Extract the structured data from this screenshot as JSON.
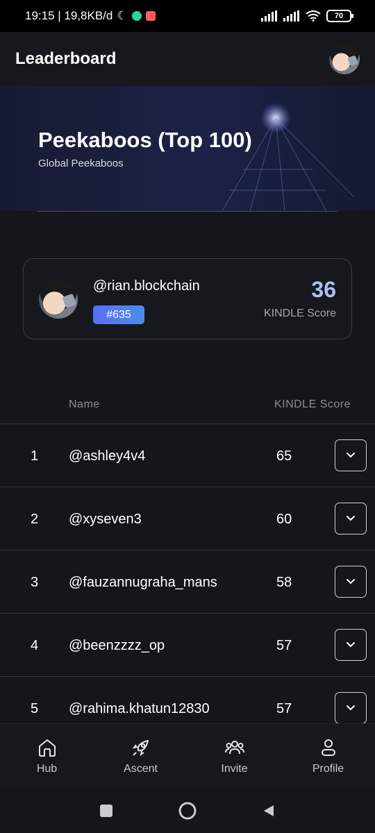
{
  "status_bar": {
    "time_info": "19:15 | 19,8KB/d",
    "battery": "70"
  },
  "header": {
    "title": "Leaderboard"
  },
  "banner": {
    "title": "Peekaboos  (Top 100)",
    "subtitle": "Global Peekaboos"
  },
  "my_rank": {
    "handle": "@rian.blockchain",
    "rank": "#635",
    "score": "36",
    "score_label": "KINDLE Score"
  },
  "table": {
    "col_name": "Name",
    "col_score": "KINDLE Score",
    "rows": [
      {
        "rank": "1",
        "name": "@ashley4v4",
        "score": "65"
      },
      {
        "rank": "2",
        "name": "@xyseven3",
        "score": "60"
      },
      {
        "rank": "3",
        "name": "@fauzannugraha_mans",
        "score": "58"
      },
      {
        "rank": "4",
        "name": "@beenzzzz_op",
        "score": "57"
      },
      {
        "rank": "5",
        "name": "@rahima.khatun12830",
        "score": "57"
      }
    ]
  },
  "nav": {
    "items": [
      {
        "label": "Hub",
        "icon": "home-icon"
      },
      {
        "label": "Ascent",
        "icon": "rocket-icon"
      },
      {
        "label": "Invite",
        "icon": "users-icon"
      },
      {
        "label": "Profile",
        "icon": "user-icon"
      }
    ]
  },
  "colors": {
    "background": "#15161b",
    "accent_score": "#a9c2ee",
    "badge_gradient_start": "#5b6cf5",
    "badge_gradient_end": "#4a8ee8"
  }
}
